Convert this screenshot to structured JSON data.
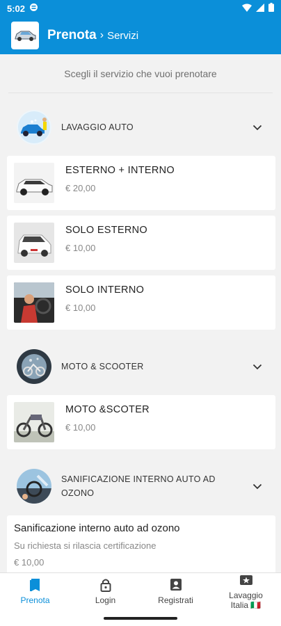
{
  "status_bar": {
    "time": "5:02"
  },
  "app_bar": {
    "title": "Prenota",
    "separator": "›",
    "breadcrumb": "Servizi"
  },
  "intro": "Scegli il servizio che vuoi prenotare",
  "categories": [
    {
      "label": "LAVAGGIO AUTO",
      "services": [
        {
          "name": "ESTERNO + INTERNO",
          "price": "€ 20,00"
        },
        {
          "name": "SOLO ESTERNO",
          "price": "€ 10,00"
        },
        {
          "name": "SOLO INTERNO",
          "price": "€ 10,00"
        }
      ]
    },
    {
      "label": "MOTO & SCOOTER",
      "services": [
        {
          "name": "MOTO &SCOTER",
          "price": "€ 10,00"
        }
      ]
    },
    {
      "label_line1": "SANIFICAZIONE INTERNO AUTO AD",
      "label_line2": "OZONO",
      "services": [
        {
          "name": "Sanificazione interno auto ad ozono",
          "note": "Su richiesta si rilascia certificazione",
          "price": "€ 10,00"
        }
      ]
    }
  ],
  "bottom_nav": [
    {
      "label": "Prenota",
      "icon": "book-icon",
      "active": true
    },
    {
      "label": "Login",
      "icon": "lock-icon"
    },
    {
      "label": "Registrati",
      "icon": "account-box-icon"
    },
    {
      "label_line1": "Lavaggio",
      "label_line2": "Italia 🇮🇹",
      "icon": "star-box-icon"
    }
  ],
  "colors": {
    "primary": "#0b8fd9",
    "background": "#f2f2f2"
  }
}
